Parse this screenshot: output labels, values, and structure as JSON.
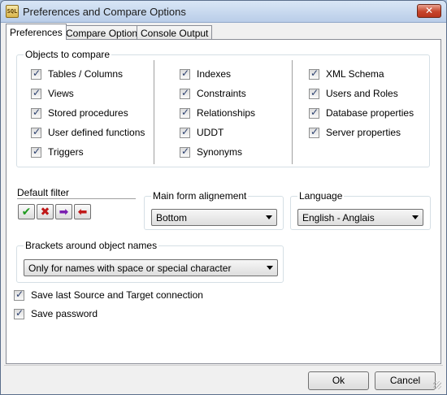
{
  "window": {
    "title": "Preferences and Compare Options",
    "icon_text": "SQL",
    "close_glyph": "✕"
  },
  "tabs": [
    {
      "label": "Preferences",
      "active": true
    },
    {
      "label": "Compare Options",
      "active": false
    },
    {
      "label": "Console Output",
      "active": false
    }
  ],
  "objects_to_compare": {
    "label": "Objects to compare",
    "col1": [
      {
        "label": "Tables / Columns",
        "checked": true
      },
      {
        "label": "Views",
        "checked": true
      },
      {
        "label": "Stored procedures",
        "checked": true
      },
      {
        "label": "User defined functions",
        "checked": true
      },
      {
        "label": "Triggers",
        "checked": true
      }
    ],
    "col2": [
      {
        "label": "Indexes",
        "checked": true
      },
      {
        "label": "Constraints",
        "checked": true
      },
      {
        "label": "Relationships",
        "checked": true
      },
      {
        "label": "UDDT",
        "checked": true
      },
      {
        "label": "Synonyms",
        "checked": true
      }
    ],
    "col3": [
      {
        "label": "XML Schema",
        "checked": true
      },
      {
        "label": "Users and Roles",
        "checked": true
      },
      {
        "label": "Database properties",
        "checked": true
      },
      {
        "label": "Server properties",
        "checked": true
      }
    ]
  },
  "default_filter": {
    "label": "Default filter",
    "buttons": [
      {
        "icon": "check-icon",
        "glyph": "✔",
        "color": "#1f9a1f"
      },
      {
        "icon": "cross-icon",
        "glyph": "✖",
        "color": "#c01818"
      },
      {
        "icon": "arrow-right-icon",
        "glyph": "➡",
        "color": "#7a1fb0"
      },
      {
        "icon": "arrow-left-icon",
        "glyph": "⬅",
        "color": "#c01818"
      }
    ]
  },
  "main_form_alignment": {
    "label": "Main form alignement",
    "value": "Bottom"
  },
  "language": {
    "label": "Language",
    "value": "English - Anglais"
  },
  "brackets": {
    "label": "Brackets around object names",
    "value": "Only for names with space or special character"
  },
  "options": [
    {
      "label": "Save last Source and Target connection",
      "checked": true
    },
    {
      "label": "Save password",
      "checked": true
    }
  ],
  "footer": {
    "ok_label": "Ok",
    "cancel_label": "Cancel"
  }
}
